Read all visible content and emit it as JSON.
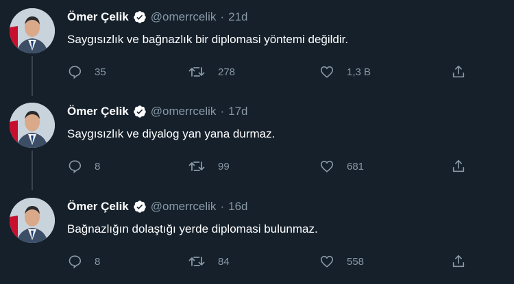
{
  "colors": {
    "background": "#15202b",
    "text_primary": "#ffffff",
    "text_secondary": "#8899a6",
    "verified": "#ffffff",
    "thread_line": "#38444d"
  },
  "tweets": [
    {
      "author": {
        "name": "Ömer Çelik",
        "handle": "@omerrcelik",
        "verified": true,
        "avatar_icon": "profile-photo"
      },
      "separator": "·",
      "time": "21d",
      "text": "Saygısızlık ve bağnazlık bir diplomasi yöntemi değildir.",
      "replies": "35",
      "retweets": "278",
      "likes": "1,3 B",
      "icons": {
        "reply": "reply-icon",
        "retweet": "retweet-icon",
        "like": "heart-icon",
        "share": "share-icon"
      }
    },
    {
      "author": {
        "name": "Ömer Çelik",
        "handle": "@omerrcelik",
        "verified": true,
        "avatar_icon": "profile-photo"
      },
      "separator": "·",
      "time": "17d",
      "text": "Saygısızlık ve diyalog yan yana durmaz.",
      "replies": "8",
      "retweets": "99",
      "likes": "681",
      "icons": {
        "reply": "reply-icon",
        "retweet": "retweet-icon",
        "like": "heart-icon",
        "share": "share-icon"
      }
    },
    {
      "author": {
        "name": "Ömer Çelik",
        "handle": "@omerrcelik",
        "verified": true,
        "avatar_icon": "profile-photo"
      },
      "separator": "·",
      "time": "16d",
      "text": "Bağnazlığın dolaştığı yerde diplomasi bulunmaz.",
      "replies": "8",
      "retweets": "84",
      "likes": "558",
      "icons": {
        "reply": "reply-icon",
        "retweet": "retweet-icon",
        "like": "heart-icon",
        "share": "share-icon"
      }
    }
  ]
}
